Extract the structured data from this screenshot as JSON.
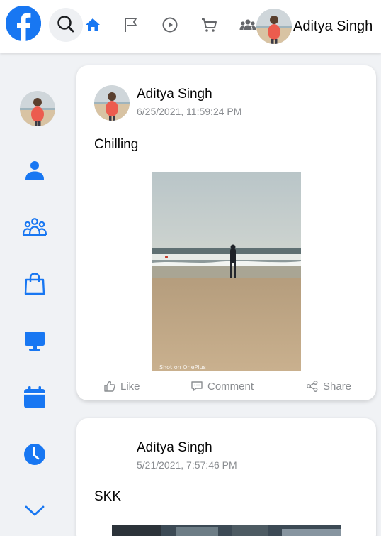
{
  "header": {
    "nav_icons": [
      "facebook-logo",
      "search-icon",
      "home-icon",
      "flag-icon",
      "video-icon",
      "marketplace-icon",
      "groups-icon"
    ],
    "user_name": "Aditya Singh"
  },
  "sidebar": {
    "items": [
      "profile-avatar",
      "person-icon",
      "groups-icon",
      "shopping-bag-icon",
      "monitor-icon",
      "calendar-icon",
      "clock-icon",
      "chevron-down-icon"
    ]
  },
  "posts": [
    {
      "author": "Aditya Singh",
      "timestamp": "6/25/2021, 11:59:24 PM",
      "text": "Chilling",
      "image_watermark": "Shot on OnePlus",
      "actions": {
        "like": "Like",
        "comment": "Comment",
        "share": "Share"
      }
    },
    {
      "author": "Aditya Singh",
      "timestamp": "5/21/2021, 7:57:46 PM",
      "text": "SKK"
    }
  ],
  "colors": {
    "brand": "#1877f2",
    "background": "#f0f2f5",
    "muted_text": "#8a8d91"
  }
}
